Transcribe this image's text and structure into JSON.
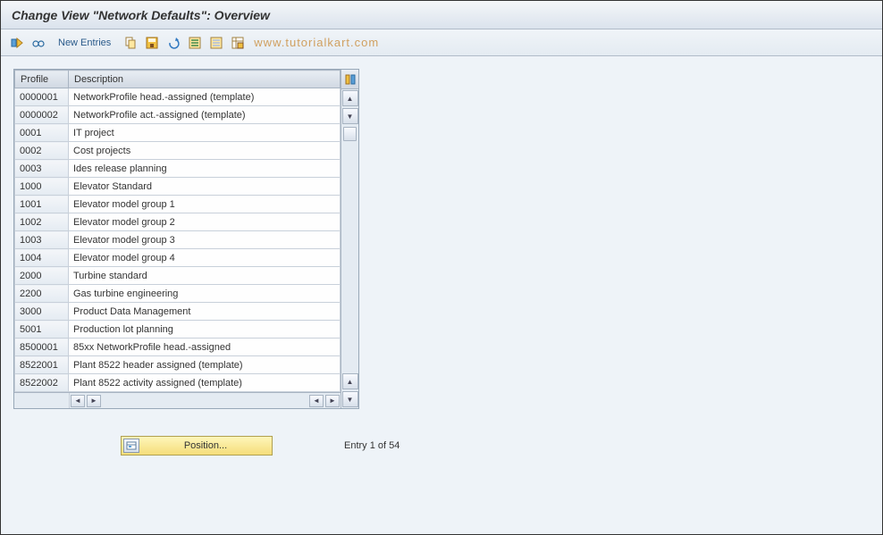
{
  "title": "Change View \"Network Defaults\": Overview",
  "toolbar": {
    "new_entries_label": "New Entries"
  },
  "watermark": "www.tutorialkart.com",
  "table": {
    "columns": {
      "profile": "Profile",
      "description": "Description"
    },
    "rows": [
      {
        "profile": "0000001",
        "description": "NetworkProfile head.-assigned (template)"
      },
      {
        "profile": "0000002",
        "description": "NetworkProfile act.-assigned (template)"
      },
      {
        "profile": "0001",
        "description": "IT project"
      },
      {
        "profile": "0002",
        "description": "Cost projects"
      },
      {
        "profile": "0003",
        "description": "Ides release planning"
      },
      {
        "profile": "1000",
        "description": "Elevator Standard"
      },
      {
        "profile": "1001",
        "description": "Elevator model group 1"
      },
      {
        "profile": "1002",
        "description": "Elevator model group 2"
      },
      {
        "profile": "1003",
        "description": "Elevator model group 3"
      },
      {
        "profile": "1004",
        "description": "Elevator model group 4"
      },
      {
        "profile": "2000",
        "description": "Turbine standard"
      },
      {
        "profile": "2200",
        "description": "Gas turbine engineering"
      },
      {
        "profile": "3000",
        "description": "Product Data Management"
      },
      {
        "profile": "5001",
        "description": "Production lot planning"
      },
      {
        "profile": "8500001",
        "description": "85xx NetworkProfile head.-assigned"
      },
      {
        "profile": "8522001",
        "description": "Plant 8522 header assigned (template)"
      },
      {
        "profile": "8522002",
        "description": "Plant 8522 activity assigned (template)"
      }
    ]
  },
  "footer": {
    "position_label": "Position...",
    "entry_text": "Entry 1 of 54"
  }
}
